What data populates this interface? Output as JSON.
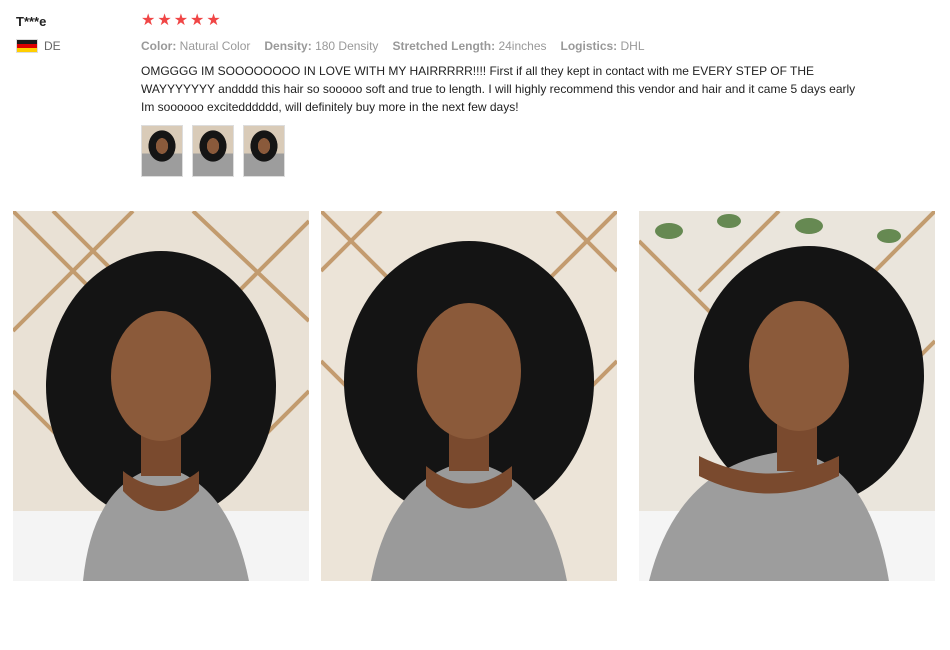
{
  "user": {
    "name": "T***e",
    "country_code": "DE",
    "flag_colors": [
      "#1a1a1a",
      "#dd0000",
      "#ffce00"
    ]
  },
  "review": {
    "rating": 5,
    "star_glyph": "★",
    "star_color": "#f04646",
    "attributes": [
      {
        "label": "Color:",
        "value": "Natural Color"
      },
      {
        "label": "Density:",
        "value": "180 Density"
      },
      {
        "label": "Stretched Length:",
        "value": "24inches"
      },
      {
        "label": "Logistics:",
        "value": "DHL"
      }
    ],
    "text": "OMGGGG IM SOOOOOOOO IN LOVE WITH MY HAIRRRRR!!!! First if all they kept in contact with me EVERY STEP OF THE WAYYYYYYY andddd this hair so sooooo soft and true to length. I will highly recommend this vendor and hair and it came 5 days early Im soooooo excitedddddd, will definitely buy more in the next few days!",
    "thumbnail_count": 3,
    "photo_count": 3
  }
}
